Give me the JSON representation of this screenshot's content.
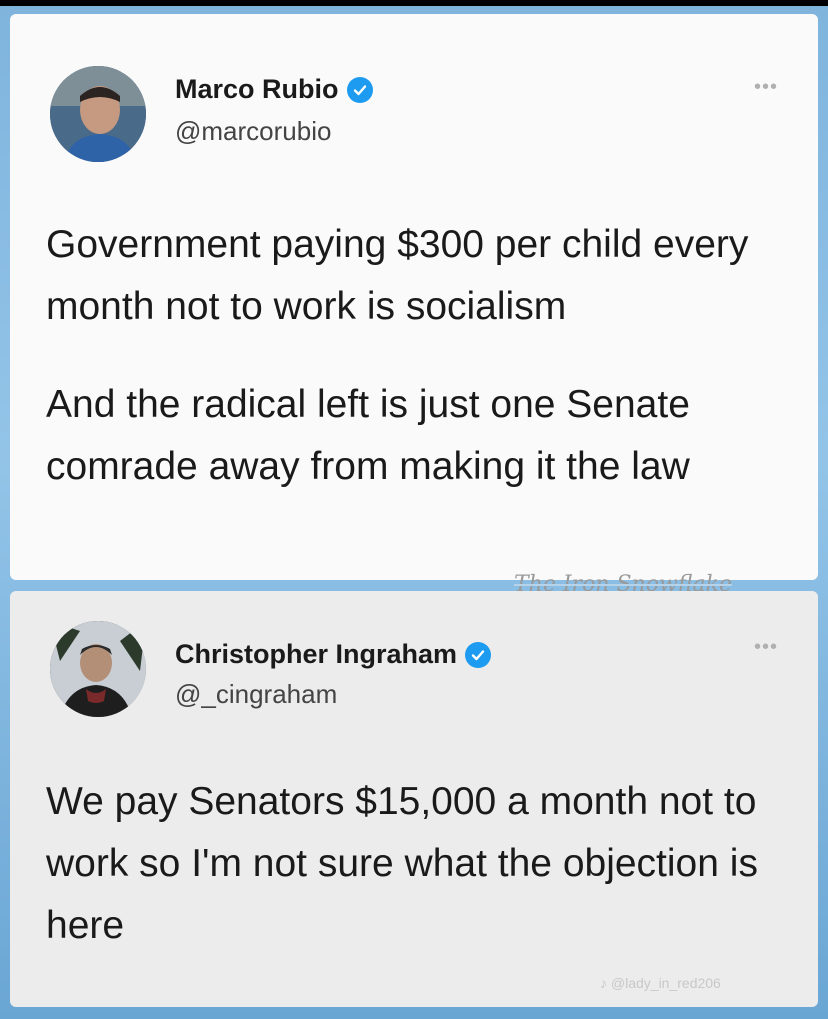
{
  "tweets": [
    {
      "author_name": "Marco Rubio",
      "handle": "@marcorubio",
      "verified": true,
      "more_icon": "more-icon",
      "paragraphs": [
        "Government paying $300 per child every month not to work is socialism",
        "And the radical left is just one Senate comrade away from making it the law"
      ]
    },
    {
      "author_name": "Christopher Ingraham",
      "handle": "@_cingraham",
      "verified": true,
      "more_icon": "more-icon",
      "paragraphs": [
        "We pay Senators $15,000 a month not to work so I'm not sure what the objection is here"
      ]
    }
  ],
  "watermarks": {
    "primary": "The Iron Snowflake",
    "secondary": "@lady_in_red206"
  },
  "colors": {
    "background": "#86bce3",
    "card1_bg": "#fafafa",
    "card2_bg": "#ececec",
    "verified": "#1d9bf0"
  }
}
